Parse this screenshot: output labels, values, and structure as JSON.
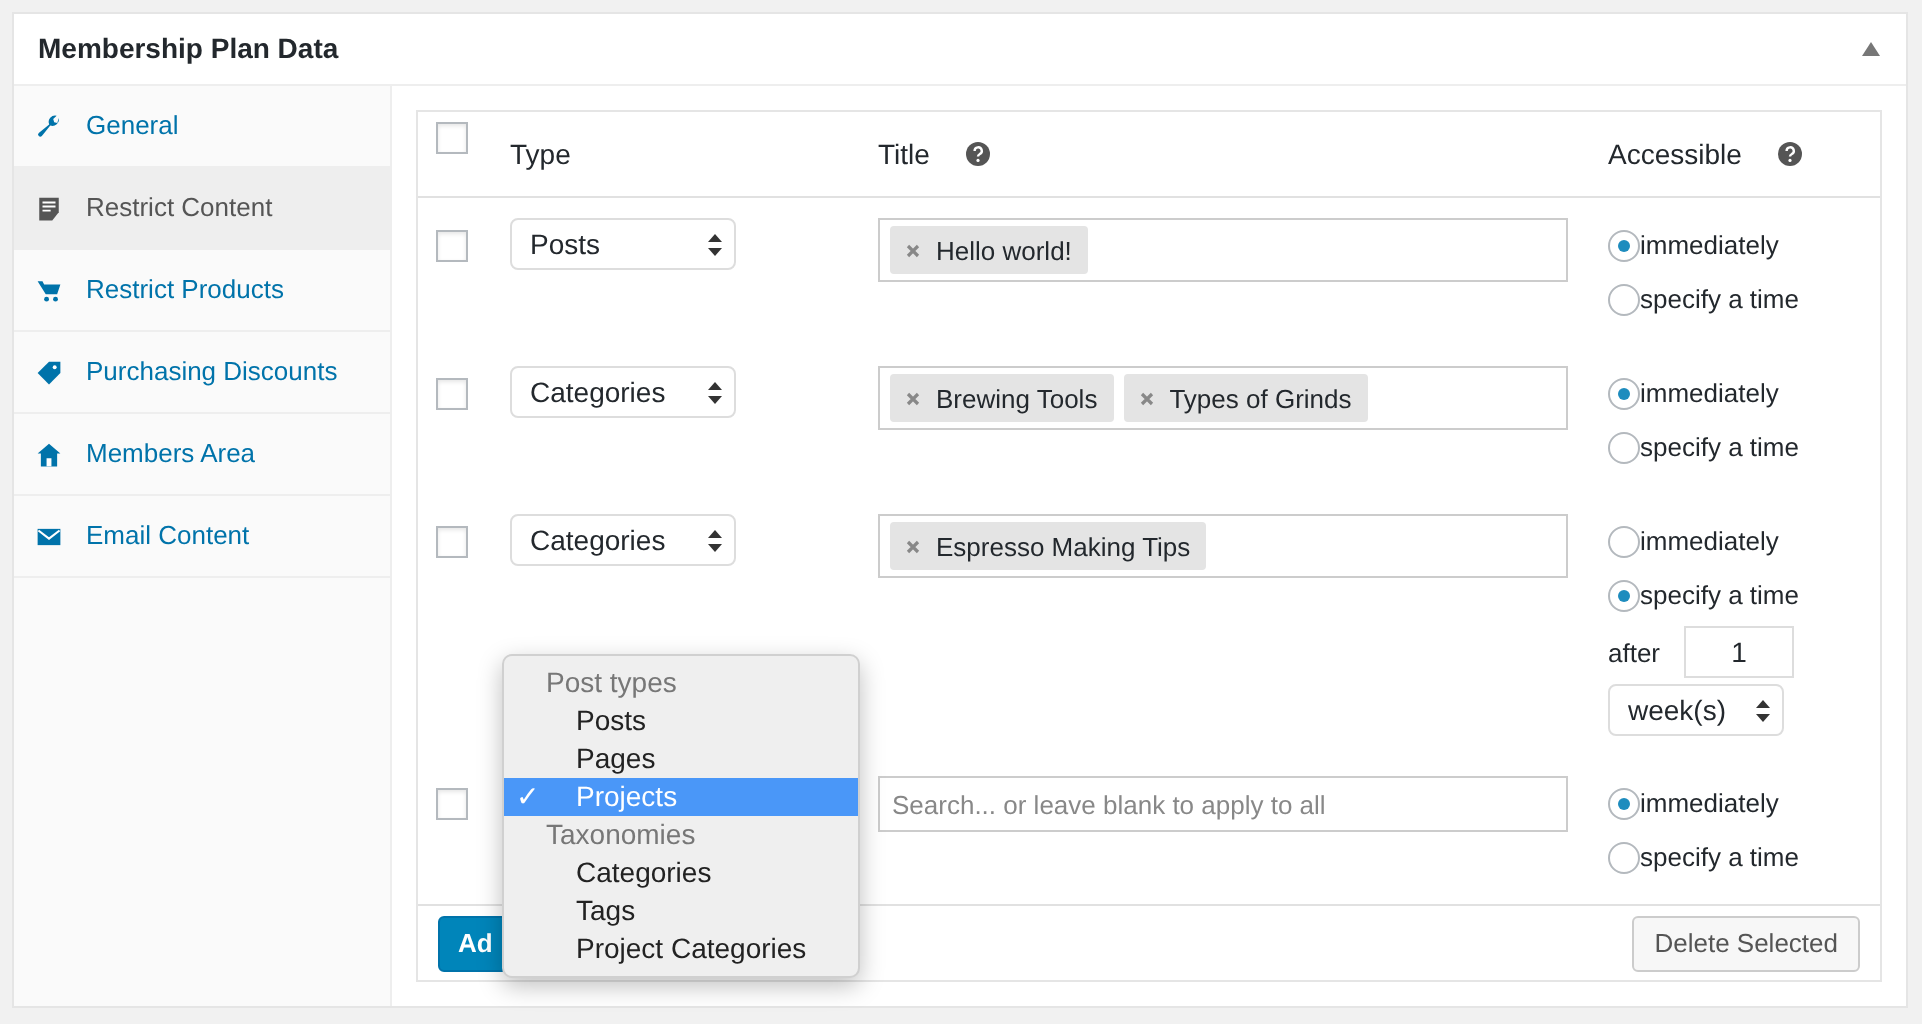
{
  "panel": {
    "title": "Membership Plan Data",
    "collapsed": false
  },
  "sidebar": {
    "items": [
      {
        "label": "General",
        "selected": false
      },
      {
        "label": "Restrict Content",
        "selected": true
      },
      {
        "label": "Restrict Products",
        "selected": false
      },
      {
        "label": "Purchasing Discounts",
        "selected": false
      },
      {
        "label": "Members Area",
        "selected": false
      },
      {
        "label": "Email Content",
        "selected": false
      }
    ]
  },
  "table": {
    "all_checked": false,
    "columns": [
      {
        "label": "Type",
        "help": false
      },
      {
        "label": "Title",
        "help": true
      },
      {
        "label": "Accessible",
        "help": true
      }
    ],
    "rows": [
      {
        "checked": false,
        "type": "Posts",
        "titles": [
          "Hello world!"
        ],
        "options": [
          {
            "label": "immediately",
            "selected": true
          },
          {
            "label": "specify a time",
            "selected": false
          }
        ]
      },
      {
        "checked": false,
        "type": "Categories",
        "titles": [
          "Brewing Tools",
          "Types of Grinds"
        ],
        "options": [
          {
            "label": "immediately",
            "selected": true
          },
          {
            "label": "specify a time",
            "selected": false
          }
        ]
      },
      {
        "checked": false,
        "type": "Categories",
        "titles": [
          "Espresso Making Tips"
        ],
        "options": [
          {
            "label": "immediately",
            "selected": false
          },
          {
            "label": "specify a time",
            "selected": true
          }
        ],
        "after": {
          "label": "after",
          "value": "1",
          "unit": "week(s)"
        }
      },
      {
        "checked": false,
        "placeholder": "Search... or leave blank to apply to all",
        "options": [
          {
            "label": "immediately",
            "selected": true
          },
          {
            "label": "specify a time",
            "selected": false
          }
        ]
      }
    ],
    "add_button": "Ad",
    "delete_button": "Delete Selected"
  },
  "dropdown": {
    "groups": [
      {
        "label": "Post types",
        "options": [
          {
            "label": "Posts",
            "selected": false
          },
          {
            "label": "Pages",
            "selected": false
          },
          {
            "label": "Projects",
            "selected": true
          }
        ]
      },
      {
        "label": "Taxonomies",
        "options": [
          {
            "label": "Categories",
            "selected": false
          },
          {
            "label": "Tags",
            "selected": false
          },
          {
            "label": "Project Categories",
            "selected": false
          }
        ]
      }
    ],
    "check": "✓"
  }
}
